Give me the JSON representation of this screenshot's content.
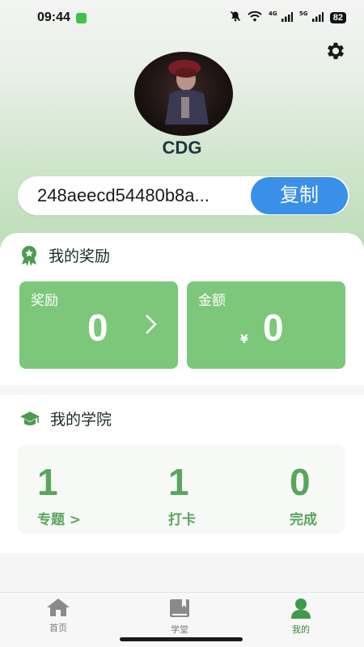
{
  "status_bar": {
    "time": "09:44",
    "network_4g": "4G",
    "network_5g": "5G",
    "battery": "82",
    "icons": [
      "chat-notification-icon",
      "mute-bell-icon",
      "wifi-icon",
      "signal-4g-icon",
      "signal-5g-icon",
      "battery-icon"
    ]
  },
  "profile": {
    "username": "CDG",
    "user_id": "248aeecd54480b8a...",
    "copy_label": "复制",
    "settings_icon": "gear-icon"
  },
  "rewards": {
    "title": "我的奖励",
    "reward_tile": {
      "label": "奖励",
      "value": "0"
    },
    "amount_tile": {
      "label": "金额",
      "currency": "¥",
      "value": "0"
    }
  },
  "academy": {
    "title": "我的学院",
    "stats": [
      {
        "value": "1",
        "label": "专题 >"
      },
      {
        "value": "1",
        "label": "打卡"
      },
      {
        "value": "0",
        "label": "完成"
      }
    ]
  },
  "tabs": [
    {
      "label": "首页",
      "icon": "home-icon",
      "active": false
    },
    {
      "label": "学堂",
      "icon": "book-icon",
      "active": false
    },
    {
      "label": "我的",
      "icon": "user-icon",
      "active": true
    }
  ],
  "colors": {
    "accent_green": "#7cc77a",
    "stat_green": "#5aa55c",
    "copy_blue": "#3a8fe8"
  }
}
